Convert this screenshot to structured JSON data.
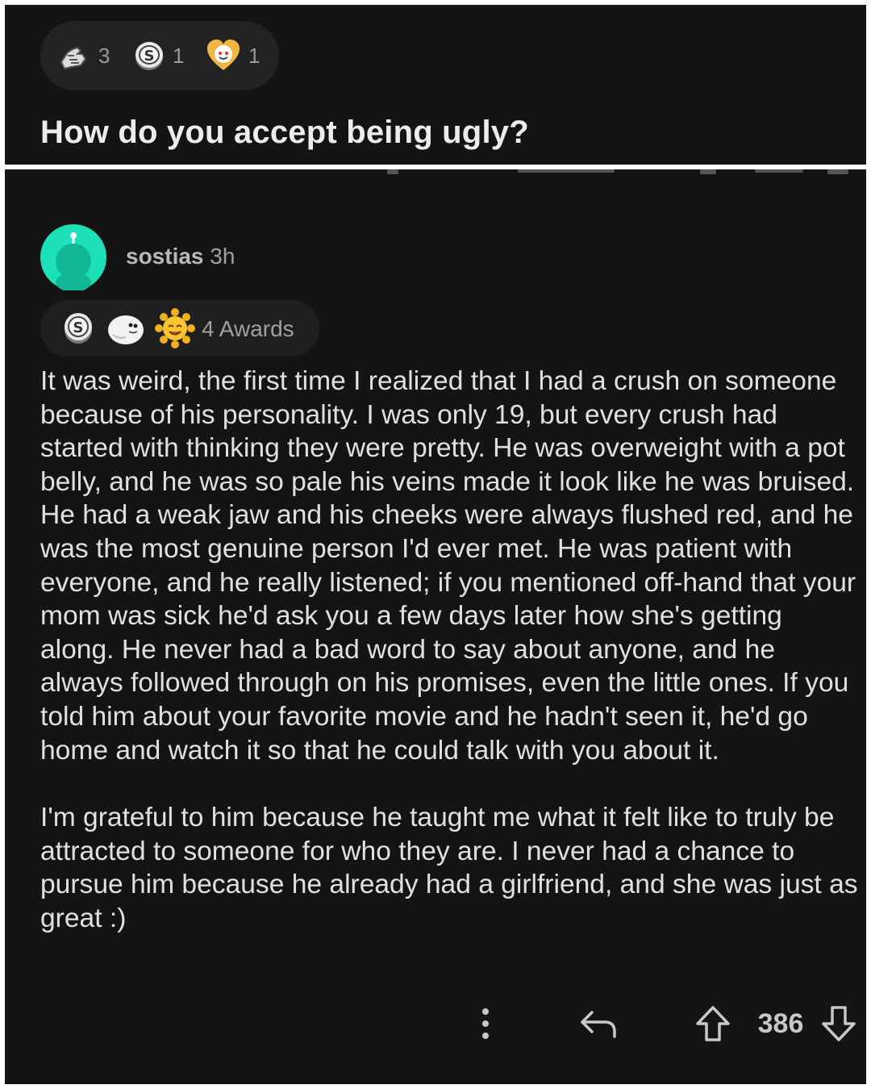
{
  "post": {
    "awards": [
      {
        "icon": "arm-wrestle-award-icon",
        "count": "3"
      },
      {
        "icon": "silver-coin-award-icon",
        "count": "1"
      },
      {
        "icon": "wholesome-heart-award-icon",
        "count": "1"
      }
    ],
    "title": "How do you accept being ugly?"
  },
  "comment": {
    "author": "sostias",
    "age": "3h",
    "awards_label": "4 Awards",
    "award_icons": [
      "silver-coin-award-icon",
      "wholesome-seal-award-icon",
      "sunflower-award-icon"
    ],
    "paragraphs": [
      "It was weird, the first time I realized that I had a crush on someone because of his personality. I was only 19, but every crush had started with thinking they were pretty. He was overweight with a pot belly, and he was so pale his veins made it look like he was bruised. He had a weak jaw and his cheeks were always flushed red, and he was the most genuine person I'd ever met. He was patient with everyone, and he really listened; if you mentioned off-hand that your mom was sick he'd ask you a few days later how she's getting along. He never had a bad word to say about anyone, and he always followed through on his promises, even the little ones. If you told him about your favorite movie and he hadn't seen it, he'd go home and watch it so that he could talk with you about it.",
      "I'm grateful to him because he taught me what it felt like to truly be attracted to someone for who they are. I never had a chance to pursue him because he already had a girlfriend, and she was just as great :)"
    ],
    "score": "386",
    "actions": [
      "more-options-icon",
      "reply-icon",
      "upvote-icon",
      "downvote-icon"
    ]
  },
  "colors": {
    "background": "#141414",
    "text": "#e0e0e0",
    "muted": "#a0a0a0",
    "avatar": "#1ee0b8"
  }
}
